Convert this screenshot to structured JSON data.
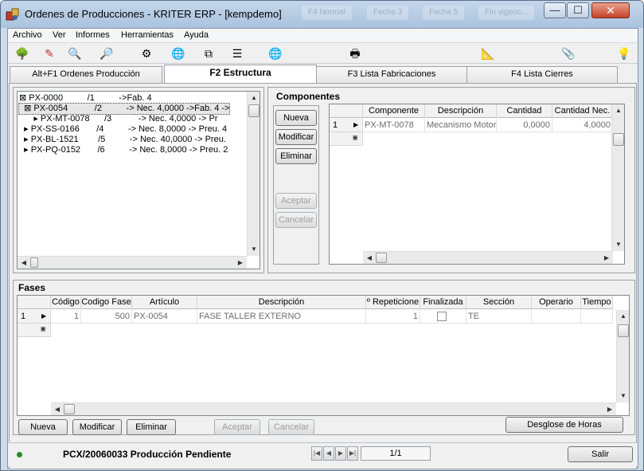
{
  "window": {
    "title": "Ordenes de Producciones - KRITER ERP - [kempdemo]",
    "ghost_tabs": [
      "F4 Normal",
      "Fecha 3",
      "Fecha 5",
      "Fin vigenc..."
    ],
    "minimize_glyph": "—",
    "maximize_glyph": "☐",
    "close_glyph": "✕"
  },
  "menu": [
    "Archivo",
    "Ver",
    "Informes",
    "Herramientas",
    "Ayuda"
  ],
  "toolbar": {
    "icons": [
      "tree-icon",
      "pen-icon",
      "preview-icon",
      "find-icon",
      "gear-report-icon",
      "world-icon",
      "copy-icon",
      "checklist-icon",
      "world-question-icon",
      "printer-icon",
      "ruler-icon",
      "paperclip-icon",
      "lightbulb-icon"
    ],
    "glyphs": [
      "🌳",
      "✎",
      "🔍",
      "🔎",
      "⚙",
      "🌐",
      "⧉",
      "☰",
      "🌐",
      "🖶",
      "📐",
      "📎",
      "💡"
    ]
  },
  "tabs": [
    {
      "label": "Alt+F1 Ordenes Producción",
      "active": false
    },
    {
      "label": "F2 Estructura",
      "active": true
    },
    {
      "label": "F3 Lista Fabricaciones",
      "active": false
    },
    {
      "label": "F4 Lista Cierres",
      "active": false
    }
  ],
  "tree": {
    "lines": [
      "⊠ PX-0000          /1          ->Fab. 4",
      "  ⊠ PX-0054           /2          -> Nec. 4,0000 ->Fab. 4 ->",
      "      ▸ PX-MT-0078      /3           -> Nec. 4,0000 -> Pr",
      "  ▸ PX-SS-0166       /4          -> Nec. 8,0000 -> Preu. 4",
      "  ▸ PX-BL-1521        /5          -> Nec. 40,0000 -> Preu.",
      "  ▸ PX-PQ-0152       /6          -> Nec. 8,0000 -> Preu. 2"
    ]
  },
  "componentes": {
    "title": "Componentes",
    "buttons": {
      "nueva": "Nueva",
      "modificar": "Modificar",
      "eliminar": "Eliminar",
      "aceptar": "Aceptar",
      "cancelar": "Cancelar"
    },
    "columns": [
      "Componente",
      "Descripción",
      "Cantidad",
      "Cantidad Nec."
    ],
    "rows": [
      {
        "n": "1",
        "componente": "PX-MT-0078",
        "descripcion": "Mecanismo Motor",
        "cantidad": "0,0000",
        "cantidad_nec": "4,0000"
      }
    ],
    "new_row_marker": "⋇"
  },
  "fases": {
    "title": "Fases",
    "columns": [
      "Código",
      "Codigo Fase",
      "Artículo",
      "Descripción",
      "º Repeticione",
      "Finalizada",
      "Sección",
      "Operario",
      "Tiempo"
    ],
    "rows": [
      {
        "n": "1",
        "codigo": "1",
        "codigo_fase": "500",
        "articulo": "PX-0054",
        "descripcion": "FASE TALLER EXTERNO",
        "repeticiones": "1",
        "finalizada": false,
        "seccion": "TE",
        "operario": "",
        "tiempo": ""
      }
    ],
    "new_row_marker": "⋇",
    "buttons": {
      "nueva": "Nueva",
      "modificar": "Modificar",
      "eliminar": "Eliminar",
      "aceptar": "Aceptar",
      "cancelar": "Cancelar",
      "desglose": "Desglose de Horas"
    }
  },
  "status": {
    "text": "PCX/20060033 Producción Pendiente",
    "record": "1/1",
    "exit_label": "Salir",
    "indicator_color": "#2a8a2a"
  }
}
